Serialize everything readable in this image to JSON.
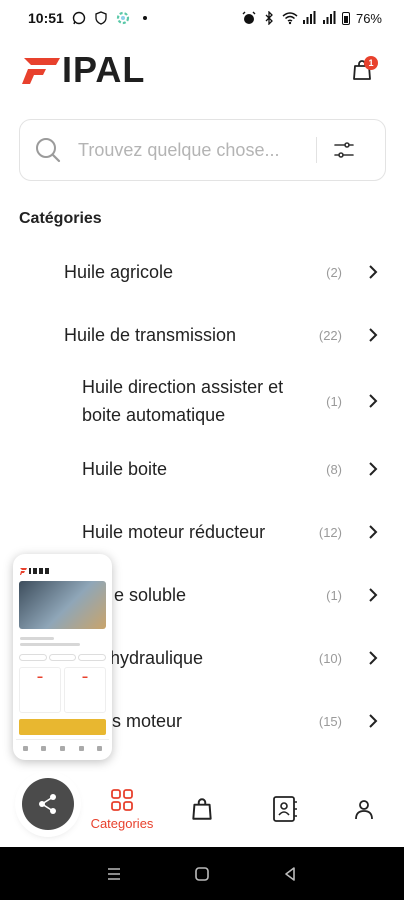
{
  "status_bar": {
    "time": "10:51",
    "battery": "76%",
    "left_icons": [
      "whatsapp-icon",
      "shield-icon",
      "settings-color-icon",
      "dot-icon"
    ],
    "right_icons": [
      "alarm-icon",
      "bluetooth-icon",
      "wifi-icon",
      "signal-icon",
      "signal-icon",
      "battery-icon"
    ]
  },
  "header": {
    "logo_text": "IPAL",
    "cart_badge": "1"
  },
  "search": {
    "placeholder": "Trouvez quelque chose..."
  },
  "section": {
    "title": "Catégories"
  },
  "categories": [
    {
      "label": "Huile agricole",
      "count": "(2)"
    },
    {
      "label": "Huile de transmission",
      "count": "(22)"
    },
    {
      "label": "Huile direction assister et",
      "label2": "boite automatique",
      "count": "(1)"
    },
    {
      "label": "Huile boite",
      "count": "(8)"
    },
    {
      "label": "Huile moteur réducteur",
      "count": "(12)"
    },
    {
      "label": "e soluble",
      "count": "(1)"
    },
    {
      "label": "hydraulique",
      "count": "(10)"
    },
    {
      "label": "s moteur",
      "count": "(15)"
    }
  ],
  "bottom_nav": {
    "categories_label": "Categories",
    "items": [
      "share-icon",
      "grid-icon",
      "bag-icon",
      "contacts-icon",
      "user-icon"
    ]
  },
  "colors": {
    "accent": "#e8412d",
    "text": "#222222",
    "muted": "#9a9a9a"
  }
}
